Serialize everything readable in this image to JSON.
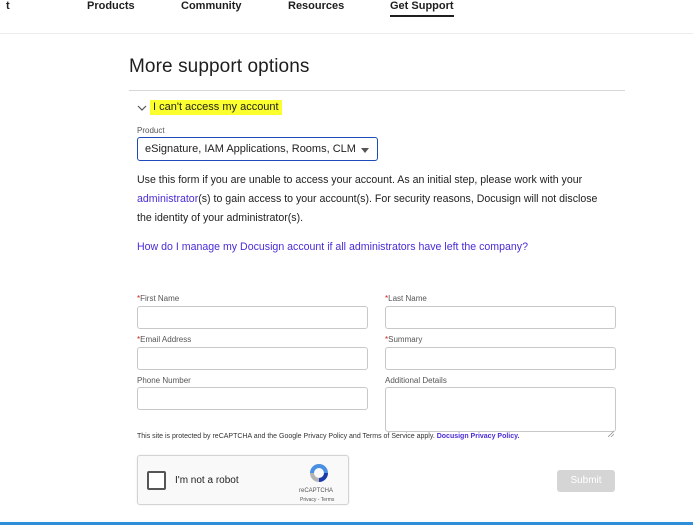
{
  "nav": {
    "stub": "t",
    "items": [
      "Products",
      "Community",
      "Resources",
      "Get Support"
    ],
    "active": "Get Support"
  },
  "page": {
    "title": "More support options"
  },
  "accordion": {
    "label": "I can't access my account",
    "highlight_color": "#fbff2e",
    "chevron_icon": "chevron-down-icon"
  },
  "product": {
    "label": "Product",
    "selected": "eSignature, IAM Applications, Rooms, CLM"
  },
  "intro": {
    "text_1": "Use this form if you are unable to access your account. As an initial step, please work with your ",
    "link": "administrator",
    "text_2": "(s) to gain access to your account(s). For security reasons, Docusign will not disclose the identity of your administrator(s)."
  },
  "faq_link": "How do I manage my Docusign account if all administrators have left the company?",
  "form": {
    "required_mark": "*",
    "first_name_label": "First Name",
    "last_name_label": "Last Name",
    "email_label": "Email Address",
    "summary_label": "Summary",
    "phone_label": "Phone Number",
    "details_label": "Additional Details"
  },
  "notice": {
    "text": "This site is protected by reCAPTCHA and the Google Privacy Policy and Terms of Service apply.",
    "link": "Docusign Privacy Policy."
  },
  "captcha": {
    "label": "I'm not a robot",
    "brand": "reCAPTCHA",
    "terms": "Privacy - Terms"
  },
  "submit_label": "Submit",
  "colors": {
    "link": "#4b2bd8",
    "select_border": "#1e4bb8",
    "required": "#d21c1c",
    "submit_disabled": "#d5d5d5",
    "bottom_bar": "#2e8fd8"
  }
}
